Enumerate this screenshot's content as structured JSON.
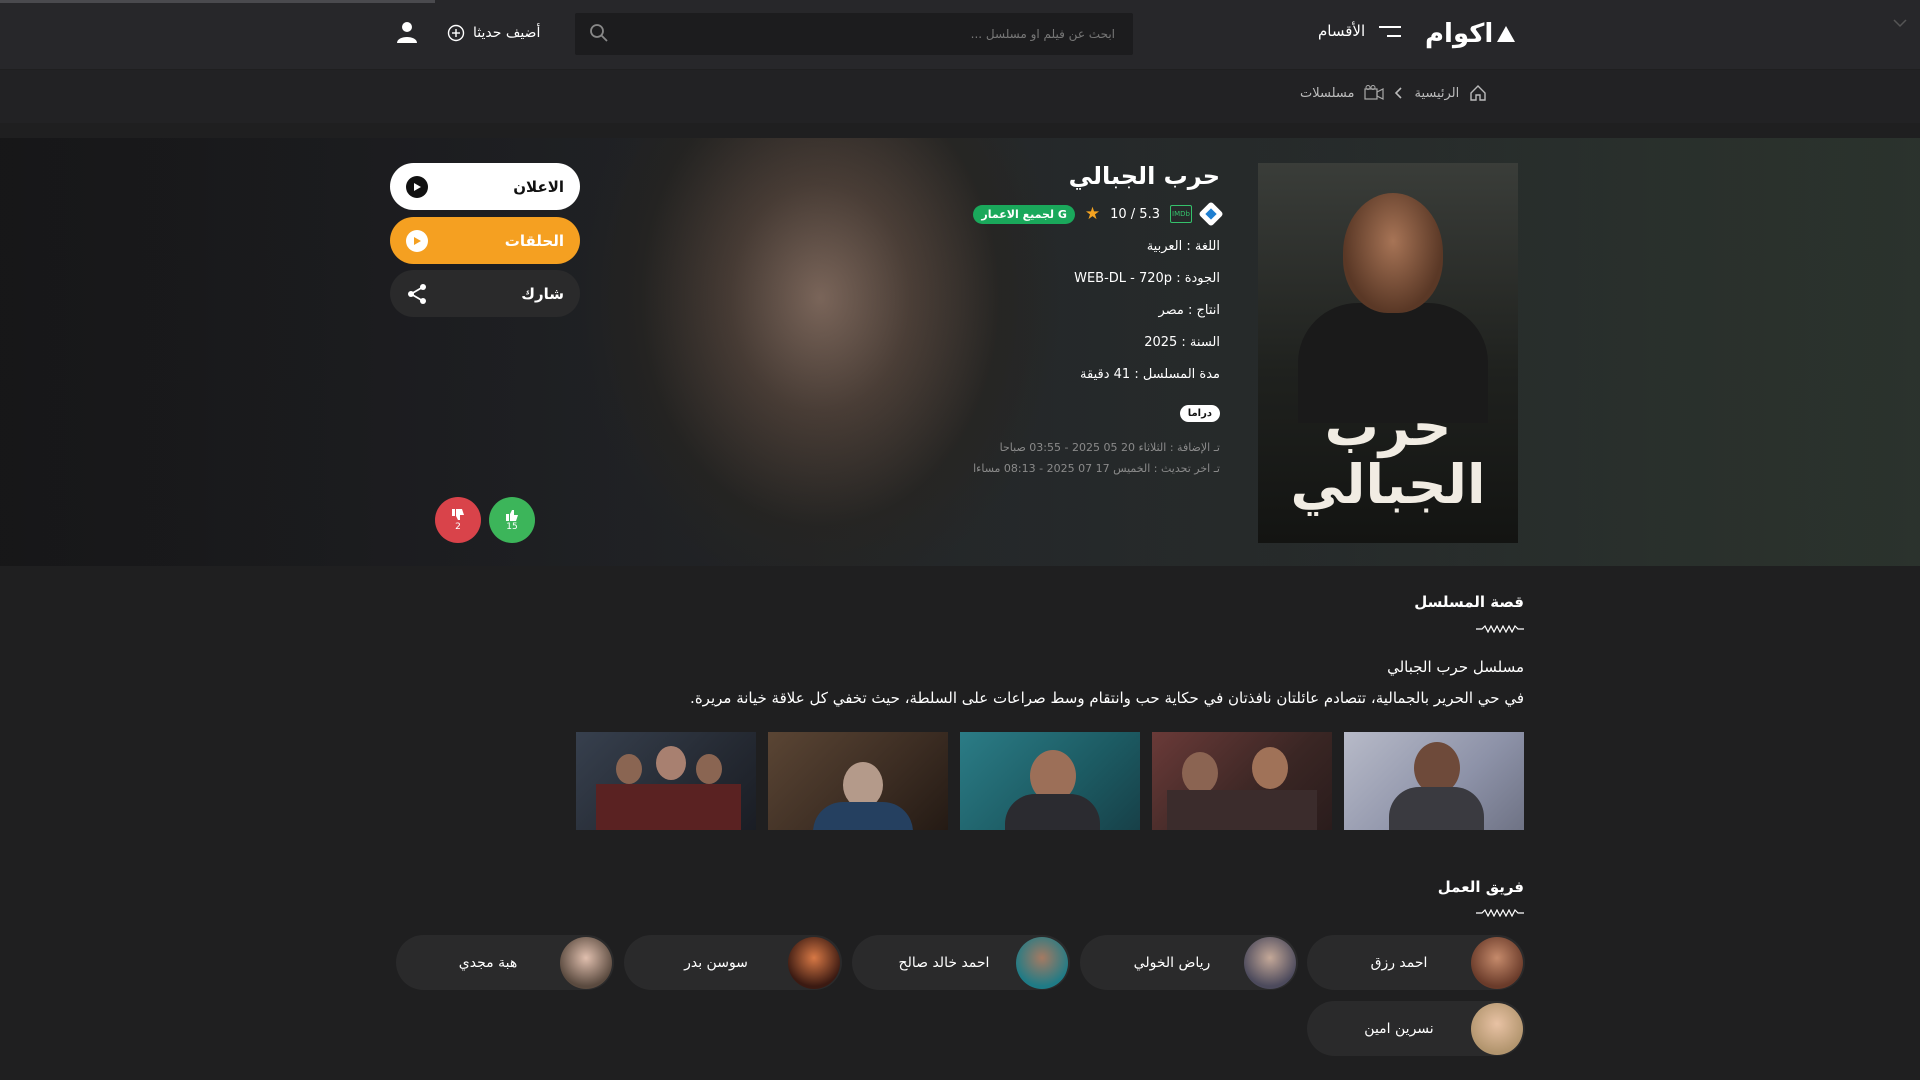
{
  "header": {
    "logo_text": "اكوام",
    "menu_label": "الأقسام",
    "search_placeholder": "ابحث عن فيلم او مسلسل ...",
    "recent_label": "أضيف حديثا"
  },
  "breadcrumb": {
    "home": "الرئيسية",
    "section": "مسلسلات"
  },
  "series": {
    "title": "حرب الجبالي",
    "poster_title": "حرب الجبالي",
    "rating_scale": "10 / 5.3",
    "age_badge": "G لجميع الاعمار",
    "language": "اللغة : العربية",
    "quality": "الجودة : WEB-DL - 720p",
    "production": "انتاج : مصر",
    "year": "السنة : 2025",
    "duration": "مدة المسلسل : 41 دقيقة",
    "genre": "دراما",
    "added": "تـ الإضافة : الثلاثاء 20 05 2025 - 03:55 صباحا",
    "updated": "تـ اخر تحديث : الخميس 17 07 2025 - 08:13 مساءا"
  },
  "actions": {
    "trailer": "الاعلان",
    "episodes": "الحلقات",
    "share": "شارك"
  },
  "votes": {
    "likes": "15",
    "dislikes": "2"
  },
  "story": {
    "heading": "قصة المسلسل",
    "line1": "مسلسل حرب الجبالي",
    "line2": "في حي الحرير بالجمالية، تتصادم عائلتان نافذتان في حكاية حب وانتقام وسط صراعات على السلطة، حيث تخفي كل علاقة خيانة مريرة."
  },
  "cast": {
    "heading": "فريق العمل",
    "members": [
      "احمد رزق",
      "رياض الخولي",
      "احمد خالد صالح",
      "سوسن بدر",
      "هبة مجدي",
      "نسرين امين"
    ]
  },
  "colors": {
    "accent": "#f5a021",
    "like": "#3cb55a",
    "dislike": "#d9434a",
    "age_badge": "#1aa85b"
  }
}
